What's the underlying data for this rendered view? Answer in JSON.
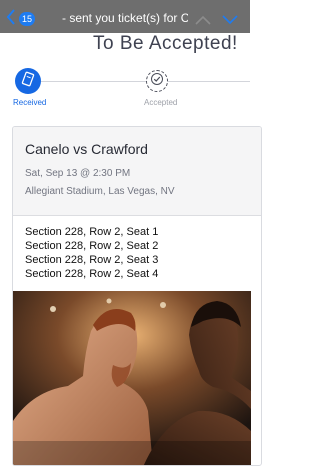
{
  "navbar": {
    "message_count": "15",
    "title": "- sent you ticket(s) for Ca...",
    "icons": [
      "back-chevron-icon",
      "chevron-up-icon",
      "chevron-down-icon"
    ]
  },
  "heading": "To Be Accepted!",
  "steps": [
    {
      "label": "Received",
      "icon": "ticket-icon",
      "state": "active"
    },
    {
      "label": "Accepted",
      "icon": "check-circle-icon",
      "state": "pending"
    }
  ],
  "event": {
    "title": "Canelo vs Crawford",
    "date": "Sat, Sep 13 @ 2:30 PM",
    "venue": "Allegiant Stadium, Las Vegas, NV",
    "seats": [
      "Section 228, Row 2, Seat 1",
      "Section 228, Row 2, Seat 2",
      "Section 228, Row 2, Seat 3",
      "Section 228, Row 2, Seat 4"
    ]
  },
  "colors": {
    "navbar": "#6e6e6e",
    "accent": "#1668e3",
    "heading": "#3f4251"
  }
}
